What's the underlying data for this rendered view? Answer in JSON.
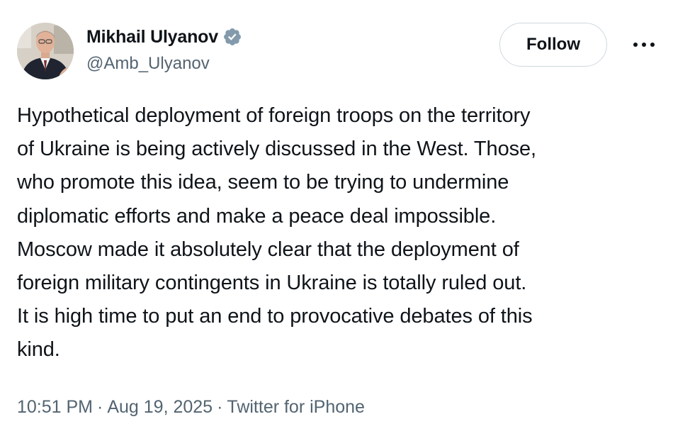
{
  "author": {
    "display_name": "Mikhail Ulyanov",
    "handle": "@Amb_Ulyanov",
    "verified": true,
    "avatar_icon": "user-photo-avatar",
    "badge_color": "#829aab"
  },
  "actions": {
    "follow_label": "Follow",
    "more_icon": "more-horizontal-icon"
  },
  "tweet": {
    "lines": [
      "Hypothetical deployment of foreign troops on the territory",
      "of Ukraine is being actively discussed in the West. Those,",
      "who promote this idea, seem to be trying to undermine",
      "diplomatic efforts and make a peace deal impossible.",
      "Moscow made it absolutely clear that the deployment of",
      "foreign military contingents in Ukraine is totally ruled out.",
      "It is high time to put an end to provocative debates of this",
      "kind."
    ]
  },
  "meta": {
    "time": "10:51 PM",
    "separator": "·",
    "date": "Aug 19, 2025",
    "source": "Twitter for iPhone"
  },
  "colors": {
    "text_primary": "#0f1419",
    "text_secondary": "#536471",
    "button_border": "#cfd9de"
  }
}
